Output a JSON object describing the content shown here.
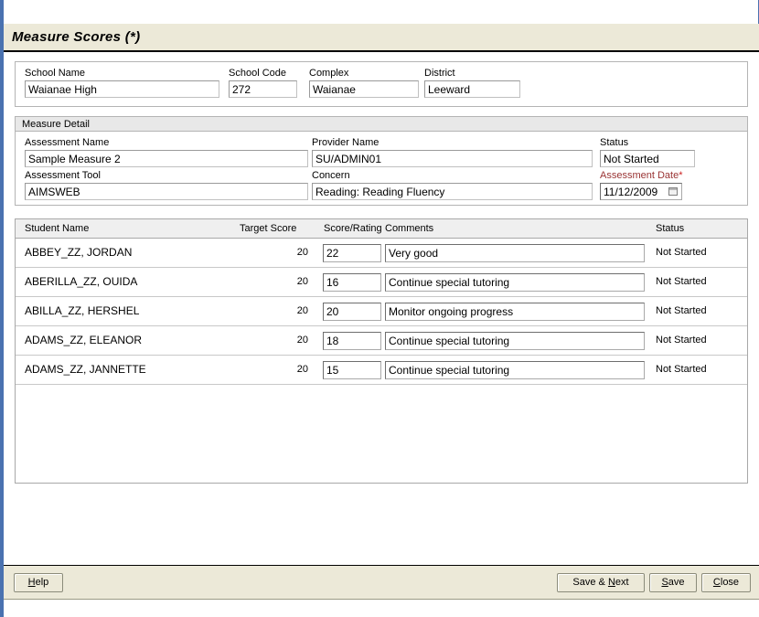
{
  "window": {
    "title": "Measure Scores (*)"
  },
  "school_panel": {
    "fields": [
      {
        "label": "School Name",
        "value": "Waianae High"
      },
      {
        "label": "School Code",
        "value": "272"
      },
      {
        "label": "Complex",
        "value": "Waianae"
      },
      {
        "label": "District",
        "value": "Leeward"
      }
    ]
  },
  "measure_detail": {
    "legend": "Measure Detail",
    "assessment_name": {
      "label": "Assessment Name",
      "value": "Sample Measure 2"
    },
    "provider_name": {
      "label": "Provider Name",
      "value": "SU/ADMIN01"
    },
    "status": {
      "label": "Status",
      "value": "Not Started"
    },
    "assessment_tool": {
      "label": "Assessment Tool",
      "value": "AIMSWEB"
    },
    "concern": {
      "label": "Concern",
      "value": "Reading: Reading Fluency"
    },
    "assessment_date": {
      "label": "Assessment Date",
      "required_marker": "*",
      "value": "11/12/2009",
      "icon": "calendar-icon"
    }
  },
  "student_table": {
    "columns": [
      "Student Name",
      "Target Score",
      "Score/Rating",
      "Comments",
      "Status"
    ],
    "rows": [
      {
        "student_name": "ABBEY_ZZ, JORDAN",
        "target_score": "20",
        "score_rating": "22",
        "comments": "Very good",
        "status": "Not Started"
      },
      {
        "student_name": "ABERILLA_ZZ, OUIDA",
        "target_score": "20",
        "score_rating": "16",
        "comments": "Continue special tutoring",
        "status": "Not Started"
      },
      {
        "student_name": "ABILLA_ZZ, HERSHEL",
        "target_score": "20",
        "score_rating": "20",
        "comments": "Monitor ongoing progress",
        "status": "Not Started"
      },
      {
        "student_name": "ADAMS_ZZ, ELEANOR",
        "target_score": "20",
        "score_rating": "18",
        "comments": "Continue special tutoring",
        "status": "Not Started"
      },
      {
        "student_name": "ADAMS_ZZ, JANNETTE",
        "target_score": "20",
        "score_rating": "15",
        "comments": "Continue special tutoring",
        "status": "Not Started"
      }
    ]
  },
  "toolbar": {
    "help": {
      "prefix": "",
      "accel": "H",
      "suffix": "elp"
    },
    "save_next": {
      "prefix": "Save & ",
      "accel": "N",
      "suffix": "ext"
    },
    "save": {
      "prefix": "",
      "accel": "S",
      "suffix": "ave"
    },
    "close": {
      "prefix": "",
      "accel": "C",
      "suffix": "lose"
    }
  },
  "colors": {
    "title_bar_bg": "#ece9d8",
    "toolbar_bg": "#ece9d8",
    "left_rail": "#4a72b0",
    "panel_head_bg": "#e8e8e8",
    "table_head_bg": "#efefef",
    "required_label": "#993333",
    "required_star": "#cc2222"
  }
}
